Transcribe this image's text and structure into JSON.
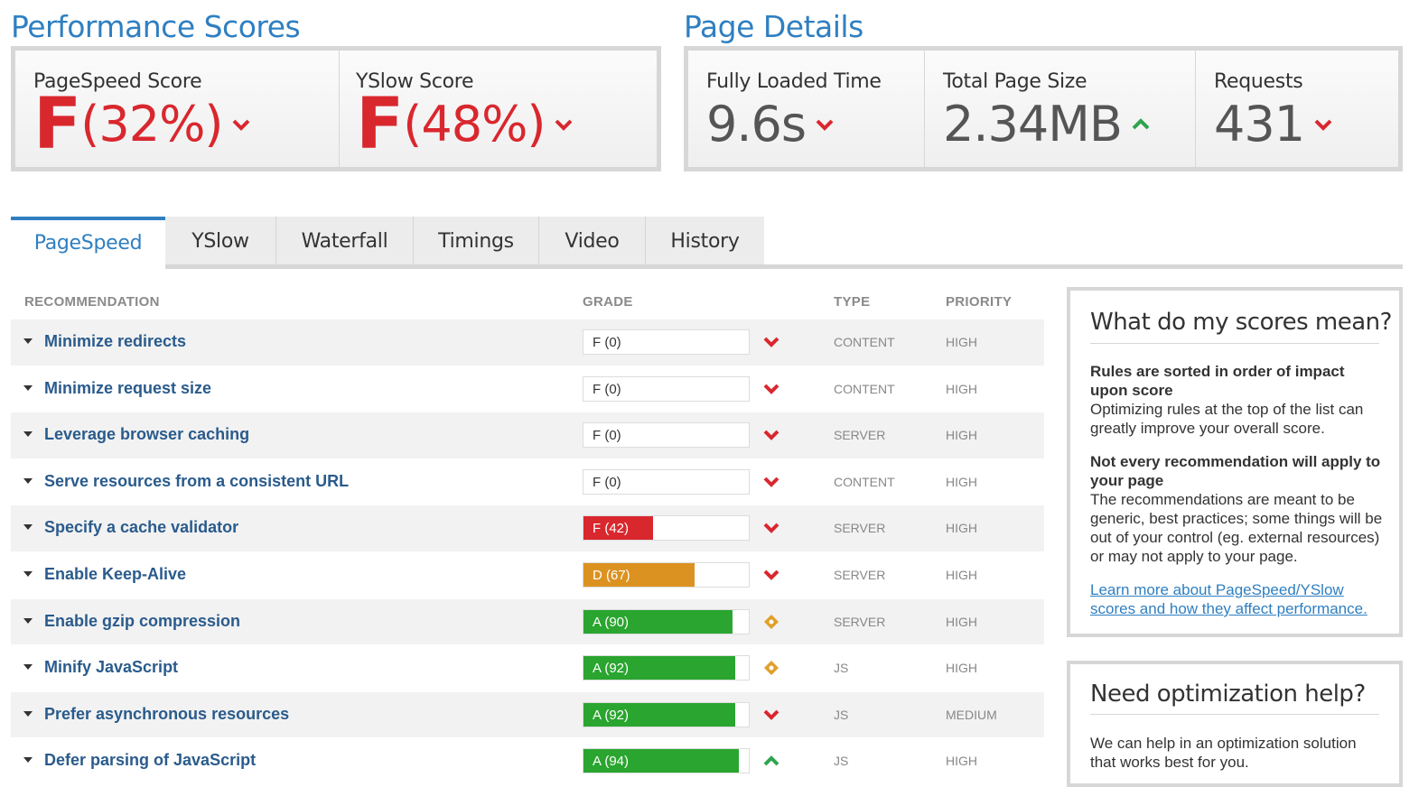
{
  "performance": {
    "title": "Performance Scores",
    "pagespeed": {
      "label": "PageSpeed Score",
      "grade": "F",
      "percent": "(32%)",
      "trend": "down"
    },
    "yslow": {
      "label": "YSlow Score",
      "grade": "F",
      "percent": "(48%)",
      "trend": "down"
    }
  },
  "details": {
    "title": "Page Details",
    "loaded": {
      "label": "Fully Loaded Time",
      "value": "9.6s",
      "trend": "down"
    },
    "size": {
      "label": "Total Page Size",
      "value": "2.34MB",
      "trend": "up"
    },
    "requests": {
      "label": "Requests",
      "value": "431",
      "trend": "down"
    }
  },
  "tabs": [
    "PageSpeed",
    "YSlow",
    "Waterfall",
    "Timings",
    "Video",
    "History"
  ],
  "table": {
    "headers": {
      "recommendation": "RECOMMENDATION",
      "grade": "GRADE",
      "type": "TYPE",
      "priority": "PRIORITY"
    },
    "rows": [
      {
        "name": "Minimize redirects",
        "grade": "F (0)",
        "score": 0,
        "type": "CONTENT",
        "priority": "HIGH",
        "icon": "down"
      },
      {
        "name": "Minimize request size",
        "grade": "F (0)",
        "score": 0,
        "type": "CONTENT",
        "priority": "HIGH",
        "icon": "down"
      },
      {
        "name": "Leverage browser caching",
        "grade": "F (0)",
        "score": 0,
        "type": "SERVER",
        "priority": "HIGH",
        "icon": "down"
      },
      {
        "name": "Serve resources from a consistent URL",
        "grade": "F (0)",
        "score": 0,
        "type": "CONTENT",
        "priority": "HIGH",
        "icon": "down"
      },
      {
        "name": "Specify a cache validator",
        "grade": "F (42)",
        "score": 42,
        "type": "SERVER",
        "priority": "HIGH",
        "icon": "down"
      },
      {
        "name": "Enable Keep-Alive",
        "grade": "D (67)",
        "score": 67,
        "type": "SERVER",
        "priority": "HIGH",
        "icon": "down"
      },
      {
        "name": "Enable gzip compression",
        "grade": "A (90)",
        "score": 90,
        "type": "SERVER",
        "priority": "HIGH",
        "icon": "neutral"
      },
      {
        "name": "Minify JavaScript",
        "grade": "A (92)",
        "score": 92,
        "type": "JS",
        "priority": "HIGH",
        "icon": "neutral"
      },
      {
        "name": "Prefer asynchronous resources",
        "grade": "A (92)",
        "score": 92,
        "type": "JS",
        "priority": "MEDIUM",
        "icon": "down"
      },
      {
        "name": "Defer parsing of JavaScript",
        "grade": "A (94)",
        "score": 94,
        "type": "JS",
        "priority": "HIGH",
        "icon": "up"
      }
    ]
  },
  "sidebar": {
    "scores": {
      "title": "What do my scores mean?",
      "p1_bold": "Rules are sorted in order of impact upon score",
      "p1_text": "Optimizing rules at the top of the list can greatly improve your overall score.",
      "p2_bold": "Not every recommendation will apply to your page",
      "p2_text": "The recommendations are meant to be generic, best practices; some things will be out of your control (eg. external resources) or may not apply to your page.",
      "link": "Learn more about PageSpeed/YSlow scores and how they affect performance."
    },
    "help": {
      "title": "Need optimization help?",
      "text": "We can help in an optimization solution that works best for you."
    }
  },
  "colors": {
    "accent": "#2f7fc1",
    "bad": "#d9272e",
    "good": "#2ea44f",
    "grade_f": "#d9272e",
    "grade_d": "#dc9221",
    "grade_a": "#2aa52f",
    "neutral_icon": "#e0a02a"
  }
}
